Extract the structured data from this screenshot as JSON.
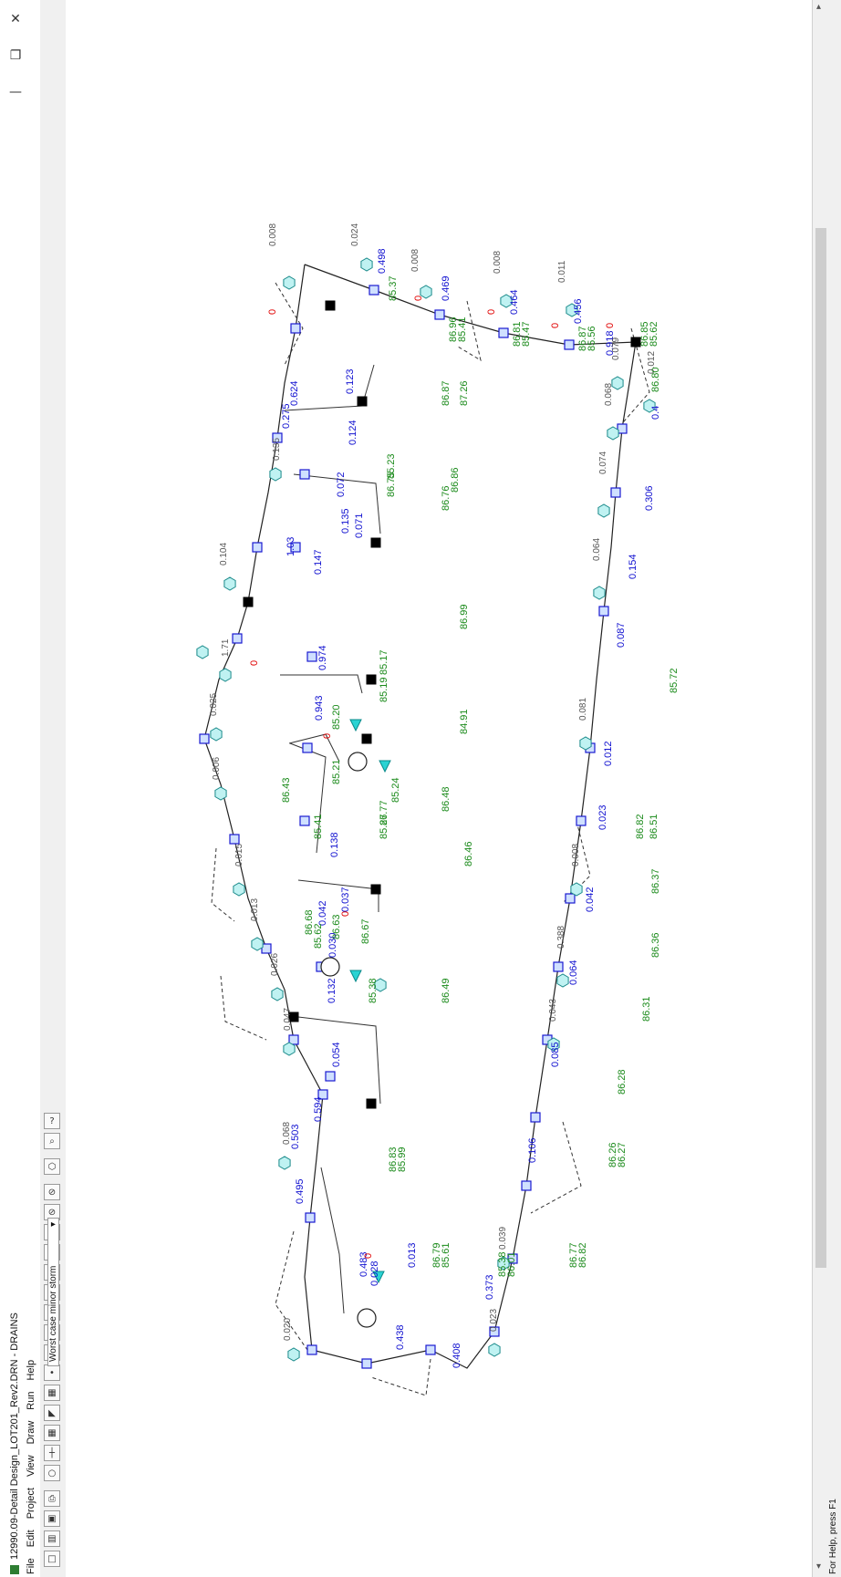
{
  "window": {
    "title": "12990.09-Detail Design_LOT201_Rev2.DRN - DRAINS",
    "close_glyph": "✕",
    "restore_glyph": "❐",
    "minimize_glyph": "—"
  },
  "menu": [
    "File",
    "Edit",
    "Project",
    "View",
    "Draw",
    "Run",
    "Help"
  ],
  "toolbar": {
    "storm_selector": "Worst case minor storm"
  },
  "status": {
    "help_text": "For Help, press F1"
  },
  "icons": {
    "app": "drains-app-icon",
    "pit": "pit-icon",
    "node": "node-icon",
    "catchment": "catchment-icon",
    "basin": "detention-basin-icon",
    "outlet": "outlet-icon"
  },
  "colors": {
    "flow_label": "#1010d0",
    "level_label": "#1a8a1a",
    "overflow_label": "#e00000",
    "pit_fill": "#cfe0ff",
    "catchment_fill": "#bff2f2"
  },
  "network": {
    "pipe_flows": [
      "0.498",
      "0.469",
      "0.464",
      "0.456",
      "0.918",
      "0.624",
      "0.275",
      "0.124",
      "0.123",
      "0.072",
      "0.071",
      "0.147",
      "0.135",
      "0.974",
      "0.943",
      "0.138",
      "0.037",
      "0.042",
      "0.030",
      "0.132",
      "0.054",
      "0.594",
      "0.503",
      "0.495",
      "0.483",
      "0.438",
      "0.408",
      "0.373",
      "0.106",
      "0.085",
      "0.064",
      "0.042",
      "0.023",
      "0.012",
      "0.087",
      "0.154",
      "0.306",
      "0.4",
      "1.03",
      "0.028",
      "0.013"
    ],
    "catchment_flows": [
      "0.008",
      "0.024",
      "0.008",
      "0.008",
      "0.011",
      "0.079",
      "0.012",
      "0.068",
      "0.074",
      "0.064",
      "0.081",
      "0.008",
      "0.388",
      "0.043",
      "0.039",
      "0.023",
      "0.020",
      "0.068",
      "0.047",
      "0.026",
      "0.013",
      "0.015",
      "0.006",
      "0.025",
      "1.71",
      "0.104",
      "0.135"
    ],
    "levels": [
      "85.37",
      "86.96",
      "85.41",
      "86.81",
      "85.47",
      "86.87",
      "85.56",
      "86.85",
      "85.62",
      "86.80",
      "85.23",
      "86.75",
      "86.87",
      "87.26",
      "86.86",
      "86.76",
      "86.99",
      "85.17",
      "85.19",
      "84.91",
      "85.20",
      "85.21",
      "86.43",
      "85.41",
      "86.68",
      "85.62",
      "86.63",
      "85.24",
      "86.48",
      "86.46",
      "86.77",
      "85.27",
      "86.67",
      "85.38",
      "86.49",
      "86.83",
      "85.99",
      "86.79",
      "85.61",
      "85.38",
      "86.01",
      "86.77",
      "86.82",
      "86.26",
      "86.27",
      "86.28",
      "86.31",
      "86.36",
      "86.37",
      "86.82",
      "86.51",
      "85.72"
    ],
    "overflows": [
      "0",
      "0",
      "0",
      "0",
      "0",
      "0",
      "0",
      "0",
      "0"
    ]
  }
}
